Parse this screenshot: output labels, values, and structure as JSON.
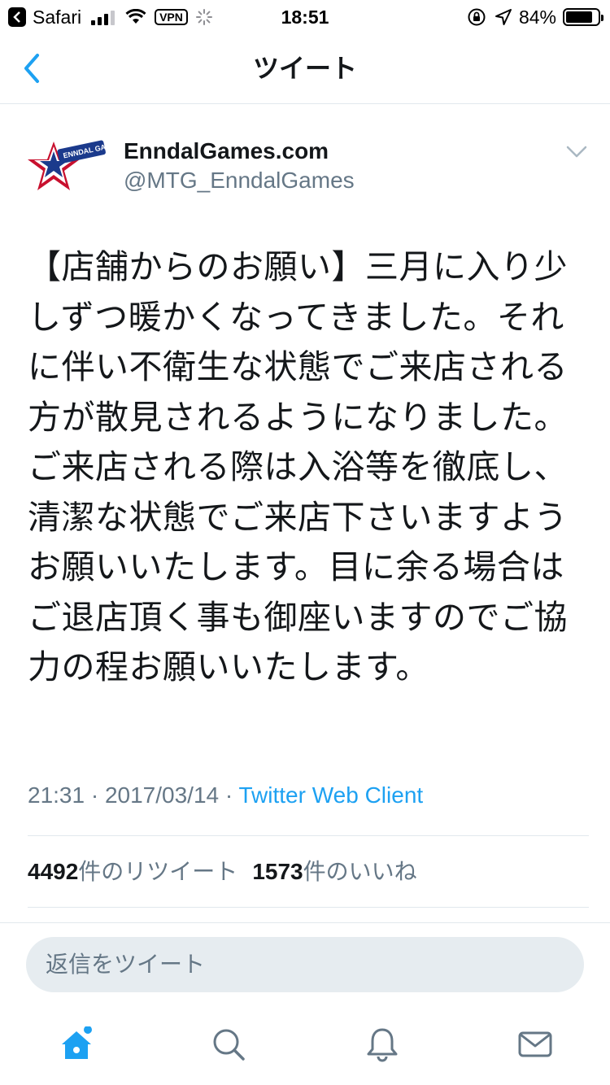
{
  "status_bar": {
    "back_app": "Safari",
    "vpn": "VPN",
    "time": "18:51",
    "battery": "84%",
    "battery_level": 0.84,
    "icons": [
      "signal-icon",
      "wifi-icon",
      "spinner-icon",
      "rotation-lock-icon",
      "location-icon",
      "battery-icon"
    ]
  },
  "nav": {
    "title": "ツイート",
    "back_icon": "chevron-left-icon"
  },
  "tweet": {
    "display_name": "EnndalGames.com",
    "handle": "@MTG_EnndalGames",
    "avatar_text": "ENNDAL GAMES",
    "avatar_icon": "star-logo",
    "text": "【店舗からのお願い】三月に入り少しずつ暖かくなってきました。それに伴い不衛生な状態でご来店される方が散見されるようになりました。ご来店される際は入浴等を徹底し、清潔な状態でご来店下さいますようお願いいたします。目に余る場合はご退店頂く事も御座いますのでご協力の程お願いいたします。",
    "time": "21:31",
    "date": "2017/03/14",
    "separator": "·",
    "client": "Twitter Web Client",
    "retweet_count": "4492",
    "retweet_label": "件のリツイート",
    "like_count": "1573",
    "like_label": "件のいいね"
  },
  "reply": {
    "placeholder": "返信をツイート"
  },
  "tab_bar": {
    "items": [
      "home-icon",
      "search-icon",
      "notifications-icon",
      "messages-icon"
    ],
    "accent": "#1da1f2",
    "inactive": "#657786"
  }
}
